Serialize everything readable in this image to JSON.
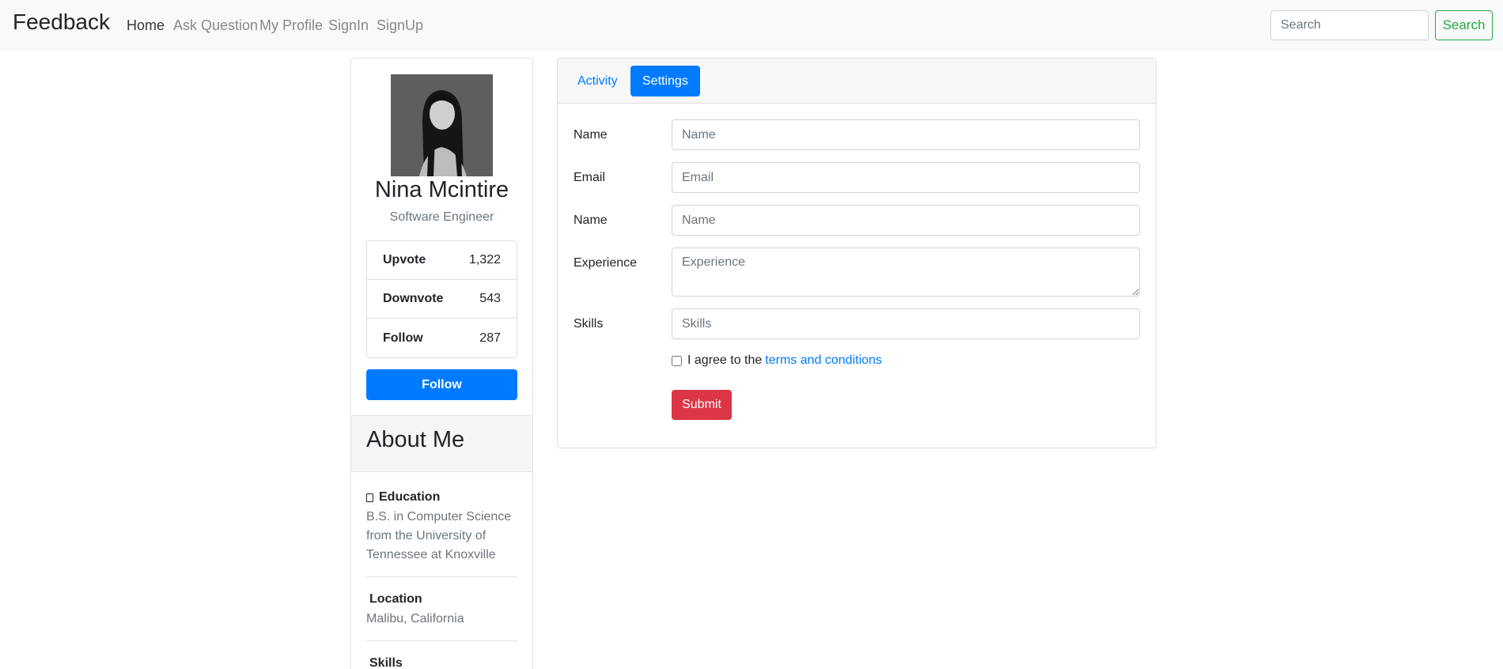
{
  "navbar": {
    "brand": "Feedback",
    "links": [
      "Home",
      "Ask Question",
      "My Profile",
      "SignIn",
      "SignUp"
    ],
    "search_placeholder": "Search",
    "search_button": "Search"
  },
  "profile": {
    "name": "Nina Mcintire",
    "role": "Software Engineer",
    "stats": [
      {
        "label": "Upvote",
        "value": "1,322"
      },
      {
        "label": "Downvote",
        "value": "543"
      },
      {
        "label": "Follow",
        "value": "287"
      }
    ],
    "follow_button": "Follow"
  },
  "about": {
    "title": "About Me",
    "education_title": "Education",
    "education_text": "B.S. in Computer Science from the University of Tennessee at Knoxville",
    "location_title": "Location",
    "location_text": "Malibu, California",
    "skills_title": "Skills"
  },
  "settings": {
    "tabs": [
      "Activity",
      "Settings"
    ],
    "active_tab": "Settings",
    "fields": [
      {
        "label": "Name",
        "placeholder": "Name"
      },
      {
        "label": "Email",
        "placeholder": "Email"
      },
      {
        "label": "Name",
        "placeholder": "Name"
      },
      {
        "label": "Experience",
        "placeholder": "Experience"
      },
      {
        "label": "Skills",
        "placeholder": "Skills"
      }
    ],
    "agree_text": "I agree to the",
    "terms_link": "terms and conditions",
    "submit_button": "Submit"
  },
  "colors": {
    "primary": "#007bff",
    "success": "#28a745",
    "danger": "#dc3545"
  }
}
